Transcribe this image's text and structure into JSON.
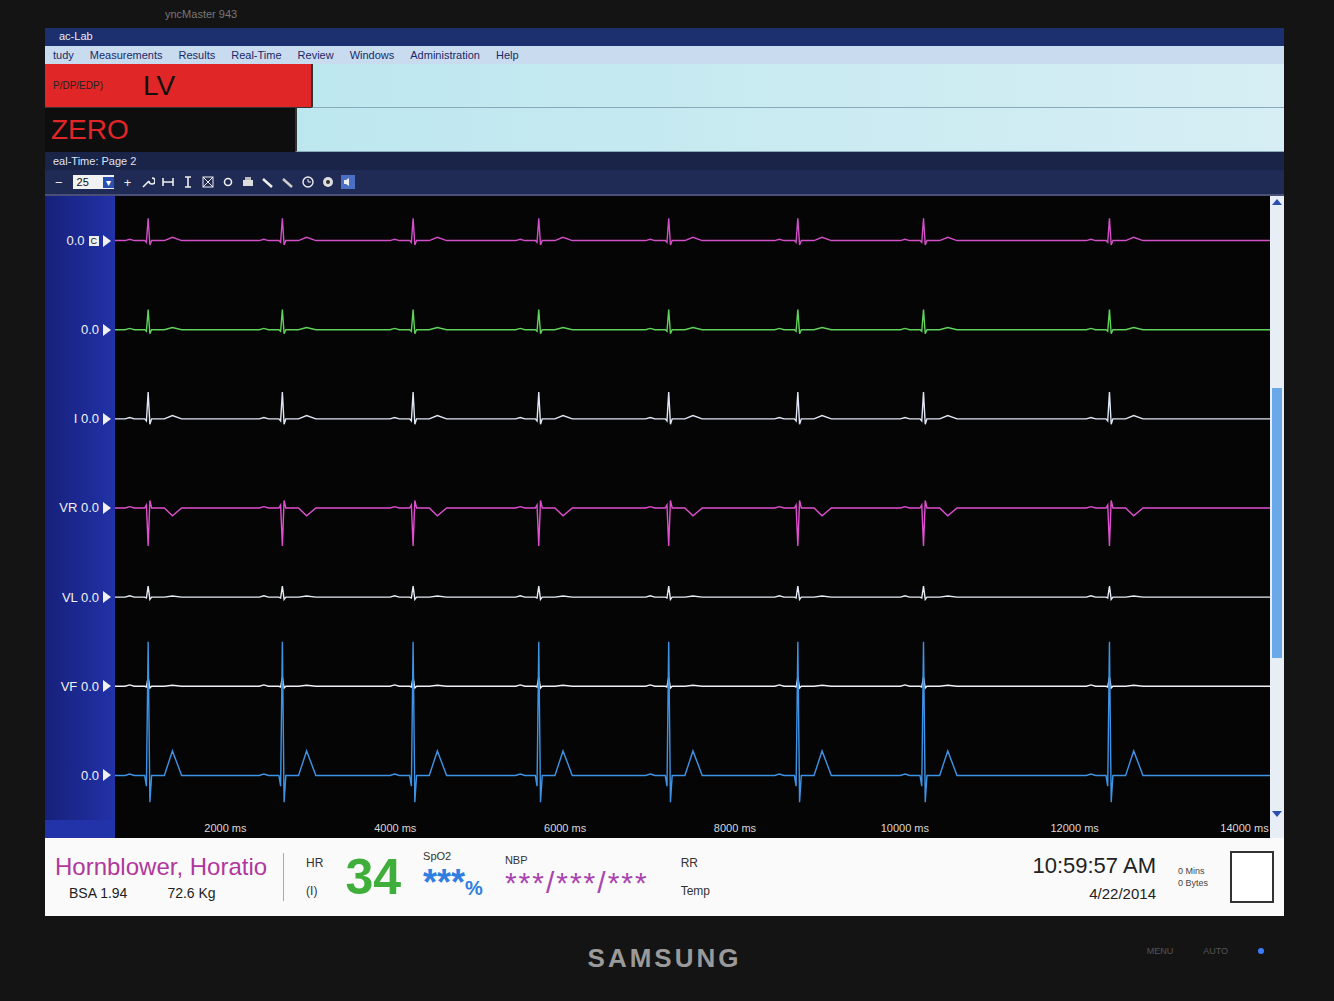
{
  "monitor": {
    "model": "yncMaster 943",
    "brand": "SAMSUNG",
    "buttons": [
      "MENU",
      "AUTO"
    ]
  },
  "app": {
    "title": "ac-Lab",
    "menu": [
      "tudy",
      "Measurements",
      "Results",
      "Real-Time",
      "Review",
      "Windows",
      "Administration",
      "Help"
    ]
  },
  "pressure": {
    "sublabel": "P/DP/EDP)",
    "site": "LV",
    "zero": "ZERO"
  },
  "page": {
    "title": "eal-Time: Page 2"
  },
  "toolbar": {
    "minus": "−",
    "sweep": "25",
    "dropdown": "▾",
    "plus": "+"
  },
  "chart": {
    "channels": [
      {
        "label": "0.0",
        "badge": "C",
        "color": "#d24fc8",
        "amplitude_mv": 1.0,
        "t_mv": 0.15
      },
      {
        "label": "0.0",
        "badge": "",
        "color": "#5fd35a",
        "amplitude_mv": 0.9,
        "t_mv": 0.1
      },
      {
        "label": "I 0.0",
        "badge": "",
        "color": "#dfe6f5",
        "amplitude_mv": 1.2,
        "t_mv": 0.15
      },
      {
        "label": "VR 0.0",
        "badge": "",
        "color": "#e04fd0",
        "amplitude_mv": -1.7,
        "t_mv": -0.35
      },
      {
        "label": "VL 0.0",
        "badge": "",
        "color": "#e6ecf5",
        "amplitude_mv": 0.5,
        "t_mv": 0.05
      },
      {
        "label": "VF 0.0",
        "badge": "",
        "color": "#f0f2f8",
        "amplitude_mv": 0.4,
        "t_mv": 0.05
      },
      {
        "label": "0.0",
        "badge": "",
        "color": "#3f93e6",
        "amplitude_mv": 6.0,
        "t_mv": 1.1
      }
    ],
    "beats_ms": [
      1090,
      2670,
      4210,
      5690,
      7220,
      8740,
      10220,
      12410
    ],
    "ticks": [
      {
        "ms": 2000,
        "label": "2000 ms"
      },
      {
        "ms": 4000,
        "label": "4000 ms"
      },
      {
        "ms": 6000,
        "label": "6000 ms"
      },
      {
        "ms": 8000,
        "label": "8000 ms"
      },
      {
        "ms": 10000,
        "label": "10000 ms"
      },
      {
        "ms": 12000,
        "label": "12000 ms"
      },
      {
        "ms": 14000,
        "label": "14000 ms"
      }
    ]
  },
  "scroll": {
    "position": 0.3,
    "size": 0.45
  },
  "status": {
    "patient": "Hornblower, Horatio",
    "bsa": "BSA 1.94",
    "weight": "72.6 Kg",
    "hr_label": "HR",
    "hr_lead": "(I)",
    "hr": "34",
    "spo2_label": "SpO2",
    "spo2": "***",
    "spo2_unit": "%",
    "nbp_label": "NBP",
    "nbp": "***/***/***",
    "rr_label": "RR",
    "temp_label": "Temp",
    "time": "10:59:57 AM",
    "date": "4/22/2014",
    "mins": "0 Mins",
    "bytes": "0 Bytes"
  }
}
